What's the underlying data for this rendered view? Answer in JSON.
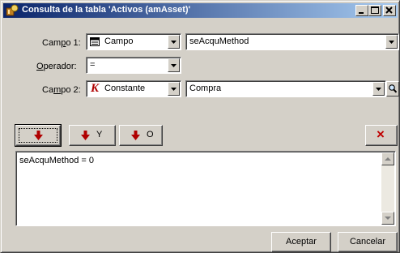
{
  "window": {
    "title": "Consulta de la tabla 'Activos (amAsset)'",
    "titlebar_color": "#0a246a",
    "controls": [
      "minimize-icon",
      "maximize-icon",
      "close-icon"
    ]
  },
  "form": {
    "campo1": {
      "label_pre": "Cam",
      "label_u": "p",
      "label_post": "o 1:",
      "type_icon": "field-grid-icon",
      "type_value": "Campo",
      "value": "seAcquMethod"
    },
    "operador": {
      "label_u": "O",
      "label_post": "perador:",
      "value": "="
    },
    "campo2": {
      "label_pre": "Ca",
      "label_u": "m",
      "label_post": "po 2:",
      "type_icon": "constant-k-icon",
      "type_icon_glyph": "K",
      "type_value": "Constante",
      "value": "Compra",
      "browse_icon": "magnifier-icon"
    }
  },
  "toolbar": {
    "insert_label": "",
    "and_label": "Y",
    "or_label": "O",
    "arrow_color": "#b00000",
    "clear_icon": "red-x-icon",
    "clear_glyph": "×"
  },
  "query": {
    "text": "seAcquMethod = 0"
  },
  "buttons": {
    "accept": "Aceptar",
    "cancel": "Cancelar"
  }
}
